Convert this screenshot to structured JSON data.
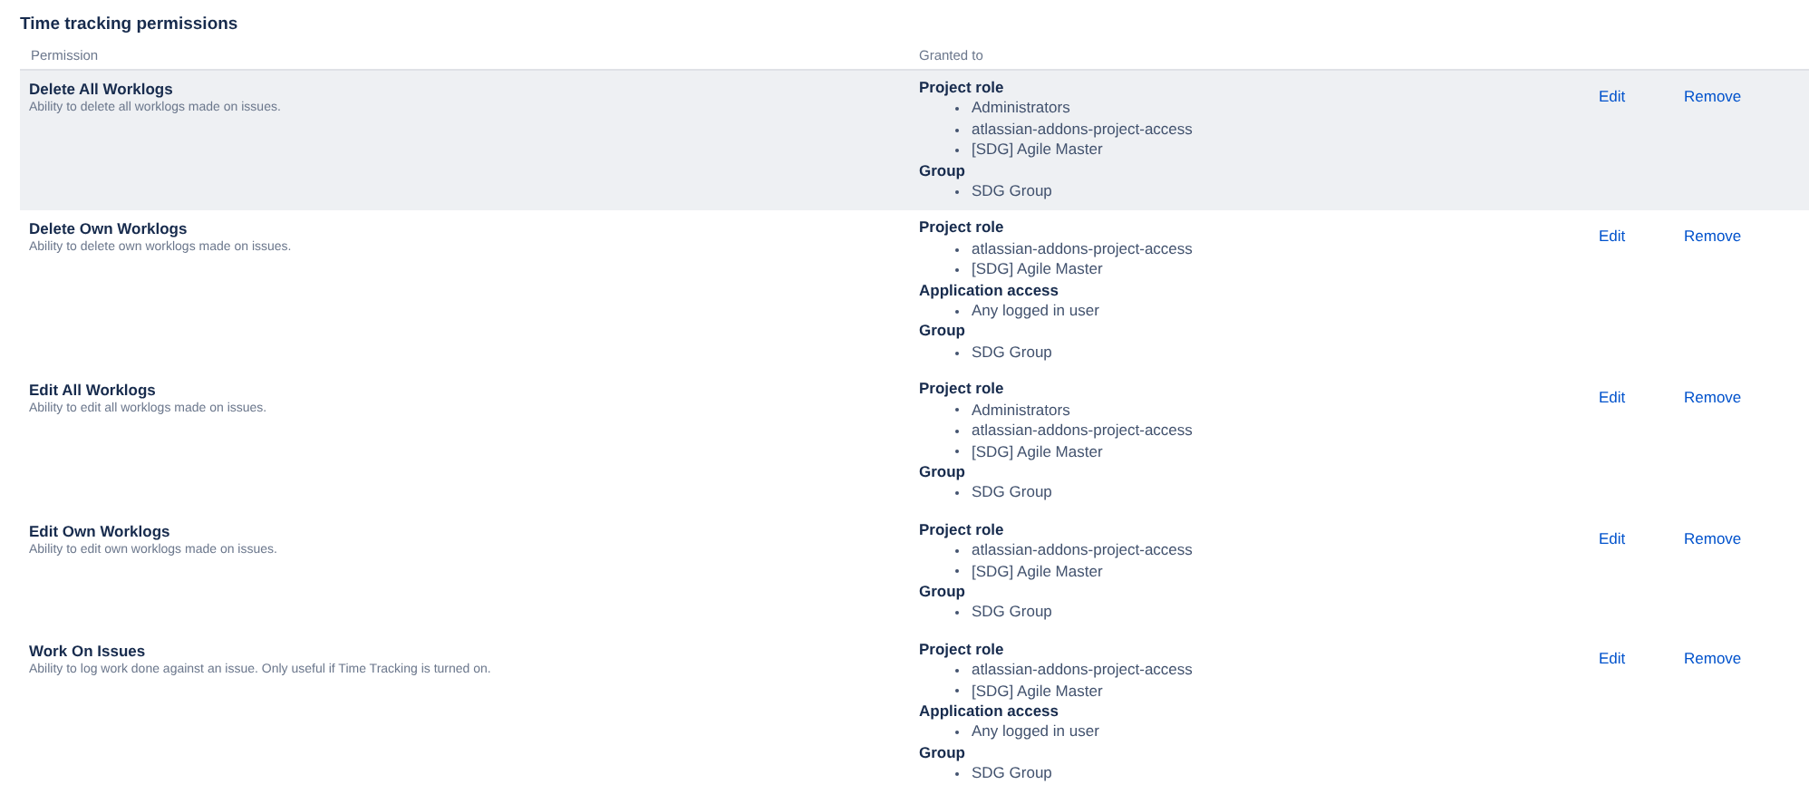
{
  "title": "Time tracking permissions",
  "columns": [
    "Permission",
    "Granted to"
  ],
  "rows": [
    {
      "name": "Delete All Worklogs",
      "description": "Ability to delete all worklogs made on issues.",
      "highlighted": true,
      "grants": [
        {
          "heading": "Project role",
          "items": [
            "Administrators",
            "atlassian-addons-project-access",
            "[SDG] Agile Master"
          ]
        },
        {
          "heading": "Group",
          "items": [
            "SDG Group"
          ]
        }
      ],
      "actions": [
        "Edit",
        "Remove"
      ]
    },
    {
      "name": "Delete Own Worklogs",
      "description": "Ability to delete own worklogs made on issues.",
      "highlighted": false,
      "grants": [
        {
          "heading": "Project role",
          "items": [
            "atlassian-addons-project-access",
            "[SDG] Agile Master"
          ]
        },
        {
          "heading": "Application access",
          "items": [
            "Any logged in user"
          ]
        },
        {
          "heading": "Group",
          "items": [
            "SDG Group"
          ]
        }
      ],
      "actions": [
        "Edit",
        "Remove"
      ]
    },
    {
      "name": "Edit All Worklogs",
      "description": "Ability to edit all worklogs made on issues.",
      "highlighted": false,
      "grants": [
        {
          "heading": "Project role",
          "items": [
            "Administrators",
            "atlassian-addons-project-access",
            "[SDG] Agile Master"
          ]
        },
        {
          "heading": "Group",
          "items": [
            "SDG Group"
          ]
        }
      ],
      "actions": [
        "Edit",
        "Remove"
      ]
    },
    {
      "name": "Edit Own Worklogs",
      "description": "Ability to edit own worklogs made on issues.",
      "highlighted": false,
      "grants": [
        {
          "heading": "Project role",
          "items": [
            "atlassian-addons-project-access",
            "[SDG] Agile Master"
          ]
        },
        {
          "heading": "Group",
          "items": [
            "SDG Group"
          ]
        }
      ],
      "actions": [
        "Edit",
        "Remove"
      ]
    },
    {
      "name": "Work On Issues",
      "description": "Ability to log work done against an issue. Only useful if Time Tracking is turned on.",
      "highlighted": false,
      "grants": [
        {
          "heading": "Project role",
          "items": [
            "atlassian-addons-project-access",
            "[SDG] Agile Master"
          ]
        },
        {
          "heading": "Application access",
          "items": [
            "Any logged in user"
          ]
        },
        {
          "heading": "Group",
          "items": [
            "SDG Group"
          ]
        }
      ],
      "actions": [
        "Edit",
        "Remove"
      ]
    }
  ]
}
